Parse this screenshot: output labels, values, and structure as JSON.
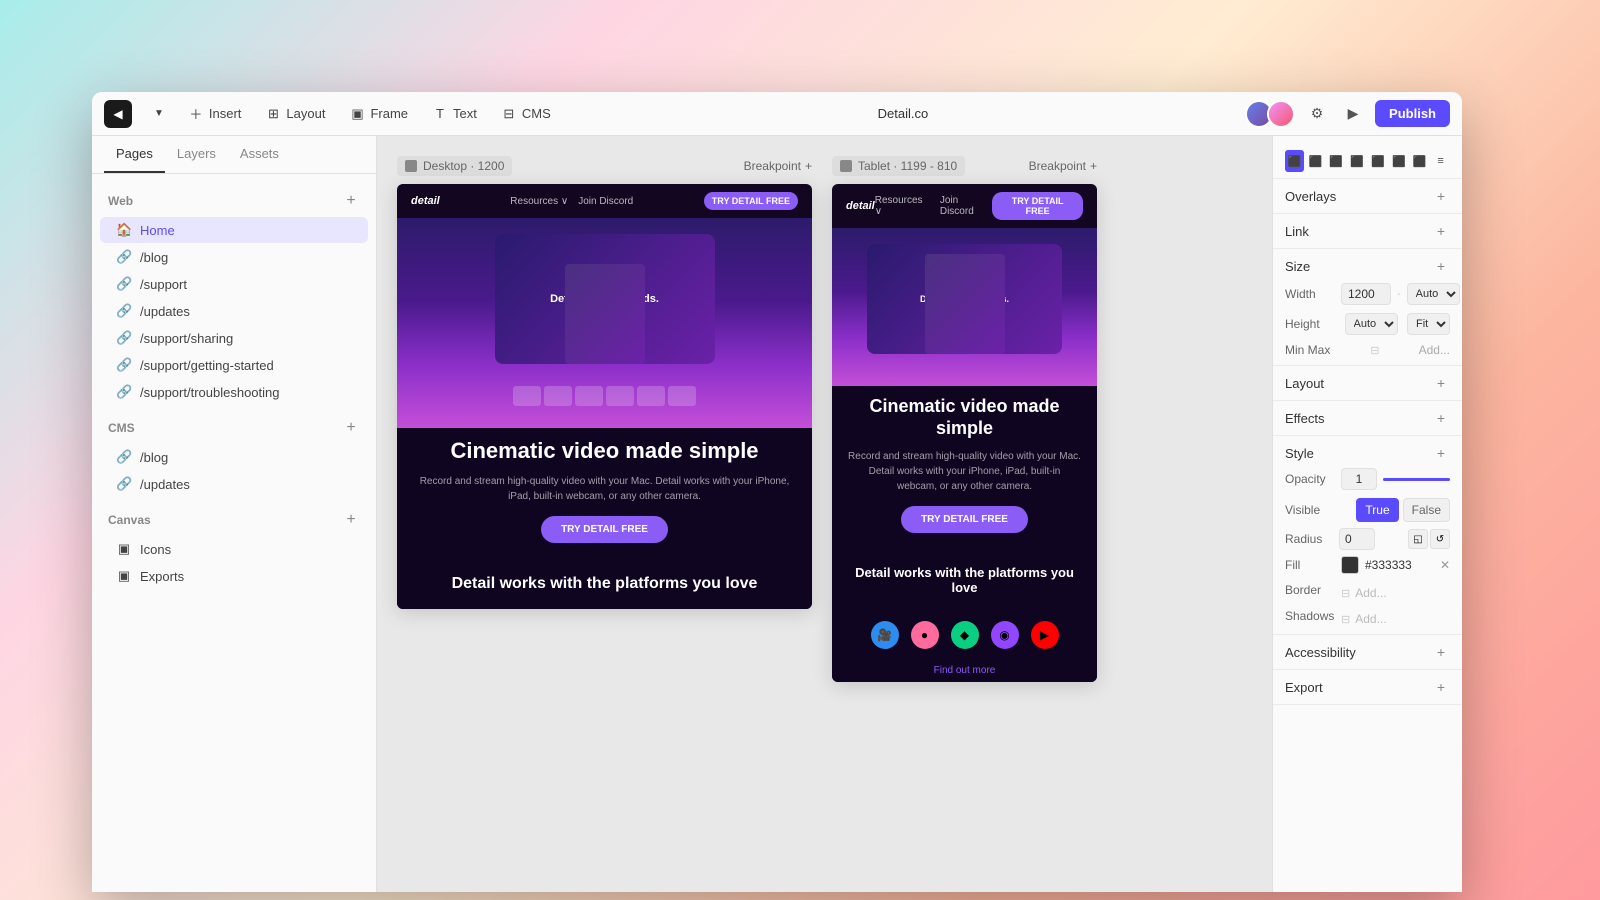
{
  "toolbar": {
    "title": "Detail.co",
    "logo_symbol": "◀",
    "insert_label": "Insert",
    "layout_label": "Layout",
    "frame_label": "Frame",
    "text_label": "Text",
    "cms_label": "CMS",
    "publish_label": "Publish"
  },
  "sidebar": {
    "tabs": [
      "Pages",
      "Layers",
      "Assets"
    ],
    "active_tab": "Pages",
    "sections": {
      "web": {
        "title": "Web",
        "items": [
          {
            "label": "Home",
            "icon": "🏠",
            "active": true
          },
          {
            "label": "/blog",
            "icon": "🔗",
            "active": false
          },
          {
            "label": "/support",
            "icon": "🔗",
            "active": false
          },
          {
            "label": "/updates",
            "icon": "🔗",
            "active": false
          },
          {
            "label": "/support/sharing",
            "icon": "🔗",
            "active": false
          },
          {
            "label": "/support/getting-started",
            "icon": "🔗",
            "active": false
          },
          {
            "label": "/support/troubleshooting",
            "icon": "🔗",
            "active": false
          }
        ]
      },
      "cms": {
        "title": "CMS",
        "items": [
          {
            "label": "/blog",
            "icon": "🔗",
            "active": false
          },
          {
            "label": "/updates",
            "icon": "🔗",
            "active": false
          }
        ]
      },
      "canvas": {
        "title": "Canvas",
        "items": [
          {
            "label": "Icons",
            "icon": "▣",
            "active": false
          },
          {
            "label": "Exports",
            "icon": "▣",
            "active": false
          }
        ]
      }
    }
  },
  "canvas": {
    "desktop": {
      "label": "Desktop · 1200",
      "breakpoint_label": "Breakpoint"
    },
    "tablet": {
      "label": "Tablet · 1199 - 810",
      "breakpoint_label": "Breakpoint"
    }
  },
  "preview": {
    "nav_logo": "detail",
    "nav_links": [
      "Resources ∨",
      "Join Discord"
    ],
    "cta_button": "TRY DETAIL FREE",
    "headline": "Cinematic video made simple",
    "subtext": "Record and stream high-quality video with your Mac. Detail works with your iPhone, iPad, built-in webcam, or any other camera.",
    "hero_btn": "TRY DETAIL FREE",
    "section_title": "Detail works with the platforms you love",
    "video_text": "Detail in 30 seconds.",
    "find_out_more": "Find out more"
  },
  "right_panel": {
    "overlays_label": "Overlays",
    "link_label": "Link",
    "size_label": "Size",
    "layout_label": "Layout",
    "effects_label": "Effects",
    "style_label": "Style",
    "accessibility_label": "Accessibility",
    "export_label": "Export",
    "width_label": "Width",
    "width_value": "1200",
    "width_auto": "Auto",
    "height_label": "Height",
    "height_value": "Auto",
    "height_fit": "Fit",
    "min_max_label": "Min Max",
    "add_label": "Add...",
    "opacity_label": "Opacity",
    "opacity_value": "1",
    "visible_label": "Visible",
    "true_label": "True",
    "false_label": "False",
    "radius_label": "Radius",
    "radius_value": "0",
    "fill_label": "Fill",
    "fill_color": "#333333",
    "border_label": "Border",
    "shadows_label": "Shadows"
  }
}
